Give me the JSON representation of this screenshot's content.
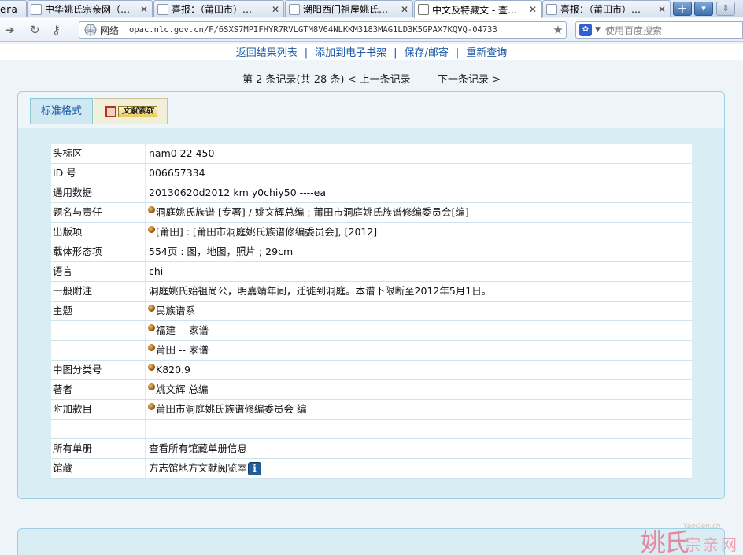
{
  "browser": {
    "tabs": [
      {
        "title": "era",
        "active": false
      },
      {
        "title": "中华姚氏宗亲网（…",
        "active": false
      },
      {
        "title": "喜报：（莆田市）…",
        "active": false
      },
      {
        "title": "潮阳西门祖屋姚氏…",
        "active": false
      },
      {
        "title": "中文及特藏文 - 查…",
        "active": true
      },
      {
        "title": "喜报：（莆田市）…",
        "active": false
      }
    ],
    "new_tab_symbol": "+",
    "menu_symbol": "▾",
    "address": {
      "net_label": "网络",
      "url": "opac.nlc.gov.cn/F/6SXS7MPIFHYR7RVLGTM8V64NLKKM3183MAG1LD3K5GPAX7KQVQ-04733"
    },
    "search_placeholder": "使用百度搜索"
  },
  "page": {
    "top_links": [
      "返回结果列表",
      "添加到电子书架",
      "保存/邮寄",
      "重新查询"
    ],
    "record_nav": {
      "position": "第 2 条记录(共 28 条)",
      "prev": "< 上一条记录",
      "next": "下一条记录 >"
    },
    "tabs": {
      "standard": "标准格式",
      "request": "文献索取"
    },
    "rows": [
      {
        "label": "头标区",
        "value": "nam0 22 450",
        "bullet": false
      },
      {
        "label": "ID 号",
        "value": "006657334",
        "bullet": false
      },
      {
        "label": "通用数据",
        "value": "20130620d2012 km y0chiy50 ----ea",
        "bullet": false
      },
      {
        "label": "题名与责任",
        "value": "洞庭姚氏族谱 [专著] / 姚文辉总编 ; 莆田市洞庭姚氏族谱修编委员会[编]",
        "bullet": true
      },
      {
        "label": "出版项",
        "value": "[莆田] : [莆田市洞庭姚氏族谱修编委员会], [2012]",
        "bullet": true
      },
      {
        "label": "载体形态项",
        "value": "554页 : 图，地图，照片 ; 29cm",
        "bullet": false
      },
      {
        "label": "语言",
        "value": "chi",
        "bullet": false
      },
      {
        "label": "一般附注",
        "value": "洞庭姚氏始祖尚公，明嘉靖年间，迁徙到洞庭。本谱下限断至2012年5月1日。",
        "bullet": false
      },
      {
        "label": "主题",
        "value": "民族谱系",
        "bullet": true
      },
      {
        "label": "",
        "value": "福建 -- 家谱",
        "bullet": true
      },
      {
        "label": "",
        "value": "莆田 -- 家谱",
        "bullet": true
      },
      {
        "label": "中图分类号",
        "value": "K820.9",
        "bullet": true
      },
      {
        "label": "著者",
        "value": "姚文辉 总编",
        "bullet": true
      },
      {
        "label": "附加款目",
        "value": "莆田市洞庭姚氏族谱修编委员会 编",
        "bullet": true
      },
      {
        "label": "",
        "value": "",
        "bullet": false
      },
      {
        "label": "所有单册",
        "value": "查看所有馆藏单册信息",
        "bullet": false
      },
      {
        "label": "馆藏",
        "value": "方志馆地方文献阅览室",
        "bullet": false,
        "info_icon": true
      }
    ],
    "info_icon_glyph": "i"
  },
  "watermark": {
    "big": "姚氏",
    "small": "宗亲网",
    "site": "YaoGen.cn"
  }
}
